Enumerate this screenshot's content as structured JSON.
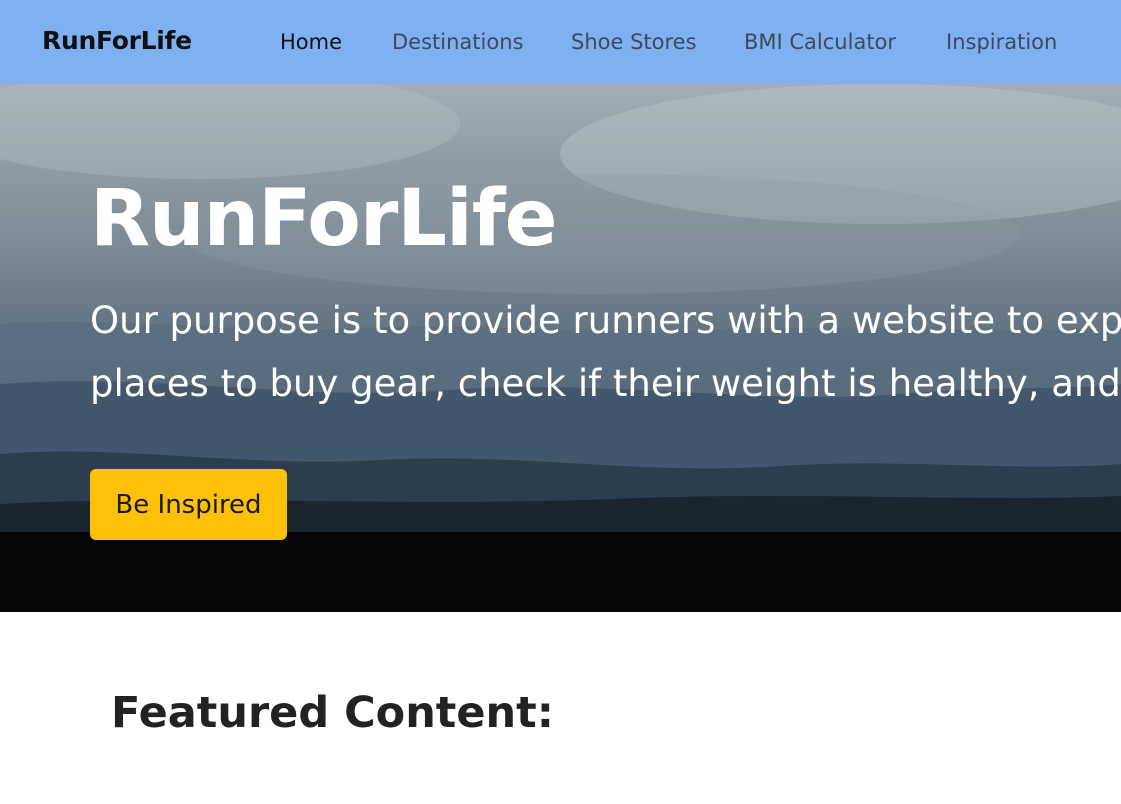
{
  "navbar": {
    "brand": "RunForLife",
    "links": [
      "Home",
      "Destinations",
      "Shoe Stores",
      "BMI Calculator",
      "Inspiration"
    ],
    "active": "Home",
    "background": "#7fb0f2"
  },
  "hero": {
    "title": "RunForLife",
    "text_line1": "Our purpose is to provide runners with a website to exp",
    "text_line2": "places to buy gear, check if their weight is healthy, and s",
    "button_label": "Be Inspired",
    "button_color": "#ffc107"
  },
  "featured": {
    "heading": "Featured Content:"
  }
}
